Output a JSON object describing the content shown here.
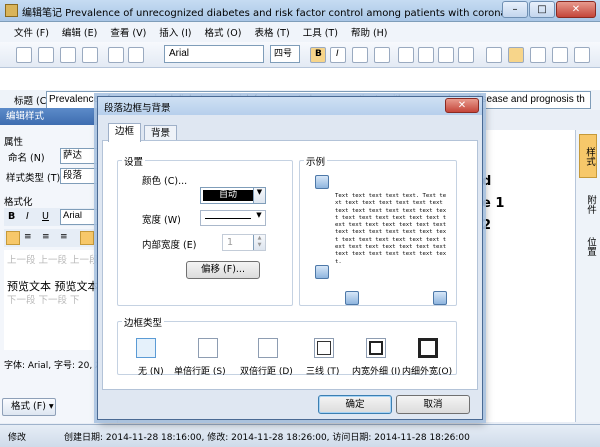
{
  "window": {
    "title": "编辑笔记 Prevalence of unrecognized diabetes and risk factor control among patients with coronary heart diseas…",
    "buttons": [
      "–",
      "□",
      "✕"
    ]
  },
  "menu": [
    "文件 (F)",
    "编辑 (E)",
    "查看 (V)",
    "插入 (I)",
    "格式 (O)",
    "表格 (T)",
    "工具 (T)",
    "帮助 (H)"
  ],
  "toolbar": {
    "font": "Arial",
    "size": "四号",
    "bold": "B",
    "italic": "I"
  },
  "note": {
    "title_label": "标题 (C)",
    "title_value": "Prevalence of unrecognized diabetes and risk factor control among patients with coronary heart disease and prognosis th"
  },
  "style_panel": {
    "header": "编辑样式",
    "section_props": "属性",
    "name_label": "命名 (N)",
    "name_value": "萨达",
    "type_label": "样式类型 (T)",
    "type_value": "段落",
    "format_label": "格式化",
    "font": "Arial",
    "preview_prev": "上一段 上一段 上一段",
    "preview_text": "预览文本 预览文本",
    "preview_next": "下一段 下一段 下",
    "font_info": "字体: Arial, 字号: 20, 左",
    "format_button": "格式 (F)"
  },
  "doc_preview": {
    "line1": "d",
    "line2": "e 1",
    "line3": "2"
  },
  "right_tabs": [
    "样式",
    "附件",
    "位置"
  ],
  "status": {
    "mode": "修改",
    "created": "创建日期: 2014-11-28 18:16:00, 修改: 2014-11-28 18:26:00, 访问日期: 2014-11-28 18:26:00"
  },
  "dialog": {
    "title": "段落边框与背景",
    "close": "✕",
    "tabs": [
      "边框",
      "背景"
    ],
    "settings_title": "设置",
    "color_label": "颜色 (C)...",
    "color_value": "自动",
    "width_label": "宽度 (W)",
    "inner_width_label": "内部宽度 (E)",
    "inner_width_value": "1",
    "offset_button": "偏移 (F)...",
    "preview_title": "示例",
    "preview_text": "Text text text text text. Text text text text text text text text text text text text text text text text text text text text text text text text text text text text text text text text text text text text text text text text text text text text text text text text text text text text text text text.",
    "border_type_title": "边框类型",
    "border_types": [
      "无 (N)",
      "单倍行距 (S)",
      "双倍行距 (D)",
      "三线 (T)",
      "内宽外细 (I)",
      "内细外宽(O)"
    ],
    "ok": "确定",
    "cancel": "取消"
  }
}
